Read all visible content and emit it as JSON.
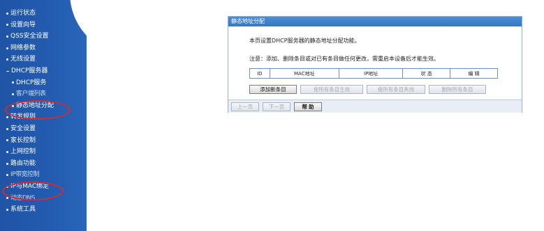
{
  "sidebar": {
    "items": [
      {
        "label": "运行状态",
        "level": 1
      },
      {
        "label": "设置向导",
        "level": 1
      },
      {
        "label": "QSS安全设置",
        "level": 1
      },
      {
        "label": "网络参数",
        "level": 1
      },
      {
        "label": "无线设置",
        "level": 1
      },
      {
        "label": "DHCP服务器",
        "level": 1,
        "expanded": true
      },
      {
        "label": "DHCP服务",
        "level": 2
      },
      {
        "label": "客户端列表",
        "level": 2
      },
      {
        "label": "静态地址分配",
        "level": 2,
        "selected": true
      },
      {
        "label": "转发规则",
        "level": 1
      },
      {
        "label": "安全设置",
        "level": 1
      },
      {
        "label": "家长控制",
        "level": 1
      },
      {
        "label": "上网控制",
        "level": 1
      },
      {
        "label": "路由功能",
        "level": 1
      },
      {
        "label": "IP带宽控制",
        "level": 1
      },
      {
        "label": "IP与MAC绑定",
        "level": 1
      },
      {
        "label": "动态DNS",
        "level": 1
      },
      {
        "label": "系统工具",
        "level": 1
      }
    ]
  },
  "panel": {
    "title": "静态地址分配",
    "intro": "本页设置DHCP服务器的静态地址分配功能。",
    "note": "注意：添加、删除条目或对已有条目做任何更改，需重启本设备后才能生效。",
    "table": {
      "columns": [
        "ID",
        "MAC地址",
        "IP地址",
        "状 态",
        "编 辑"
      ]
    },
    "buttons": {
      "add": "添加新条目",
      "enable_all": "使所有条目生效",
      "disable_all": "使所有条目失效",
      "delete_all": "删除所有条目"
    },
    "footer": {
      "prev": "上一页",
      "next": "下一页",
      "help": "帮 助"
    }
  },
  "annotations": {
    "color": "#d62b2b",
    "circled_items": [
      "静态地址分配",
      "IP与MAC绑定"
    ]
  },
  "colors": {
    "sidebar_bg": "#235cb0",
    "panel_title_bg": "#3776c4",
    "panel_border": "#8fb4dc"
  }
}
